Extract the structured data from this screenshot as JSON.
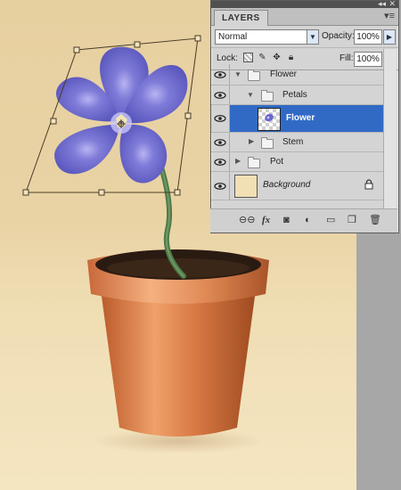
{
  "panel": {
    "tab_label": "LAYERS",
    "collapse_glyph": "◂◂",
    "close_glyph": "✕",
    "menu_glyph": "▾≡",
    "blend_mode": "Normal",
    "opacity_label": "Opacity:",
    "opacity_value": "100%",
    "lock_label": "Lock:",
    "fill_label": "Fill:",
    "fill_value": "100%",
    "selection_color": "#316ac5"
  },
  "layers": [
    {
      "name": "Flower",
      "type": "group",
      "expanded": true,
      "visible": true
    },
    {
      "name": "Petals",
      "type": "group",
      "expanded": true,
      "visible": true
    },
    {
      "name": "Flower",
      "type": "layer",
      "selected": true,
      "visible": true
    },
    {
      "name": "Stem",
      "type": "group",
      "expanded": false,
      "visible": true
    },
    {
      "name": "Pot",
      "type": "group",
      "expanded": false,
      "visible": true
    },
    {
      "name": "Background",
      "type": "background",
      "locked": true,
      "visible": true
    }
  ],
  "footer_icons": [
    "link-icon",
    "fx-icon",
    "mask-icon",
    "adjustment-icon",
    "new-group-icon",
    "new-layer-icon",
    "trash-icon"
  ],
  "footer_glyphs": {
    "link": "⊖⊖",
    "fx": "fx",
    "mask": "◙",
    "adjust": "◐",
    "group": "▭",
    "new": "❐",
    "trash": "🗑"
  },
  "artwork": {
    "petal_color": "#6a66cc",
    "pot_color": "#d97a45",
    "stem_color": "#4f7a4a",
    "soil_color": "#2a1b12"
  }
}
